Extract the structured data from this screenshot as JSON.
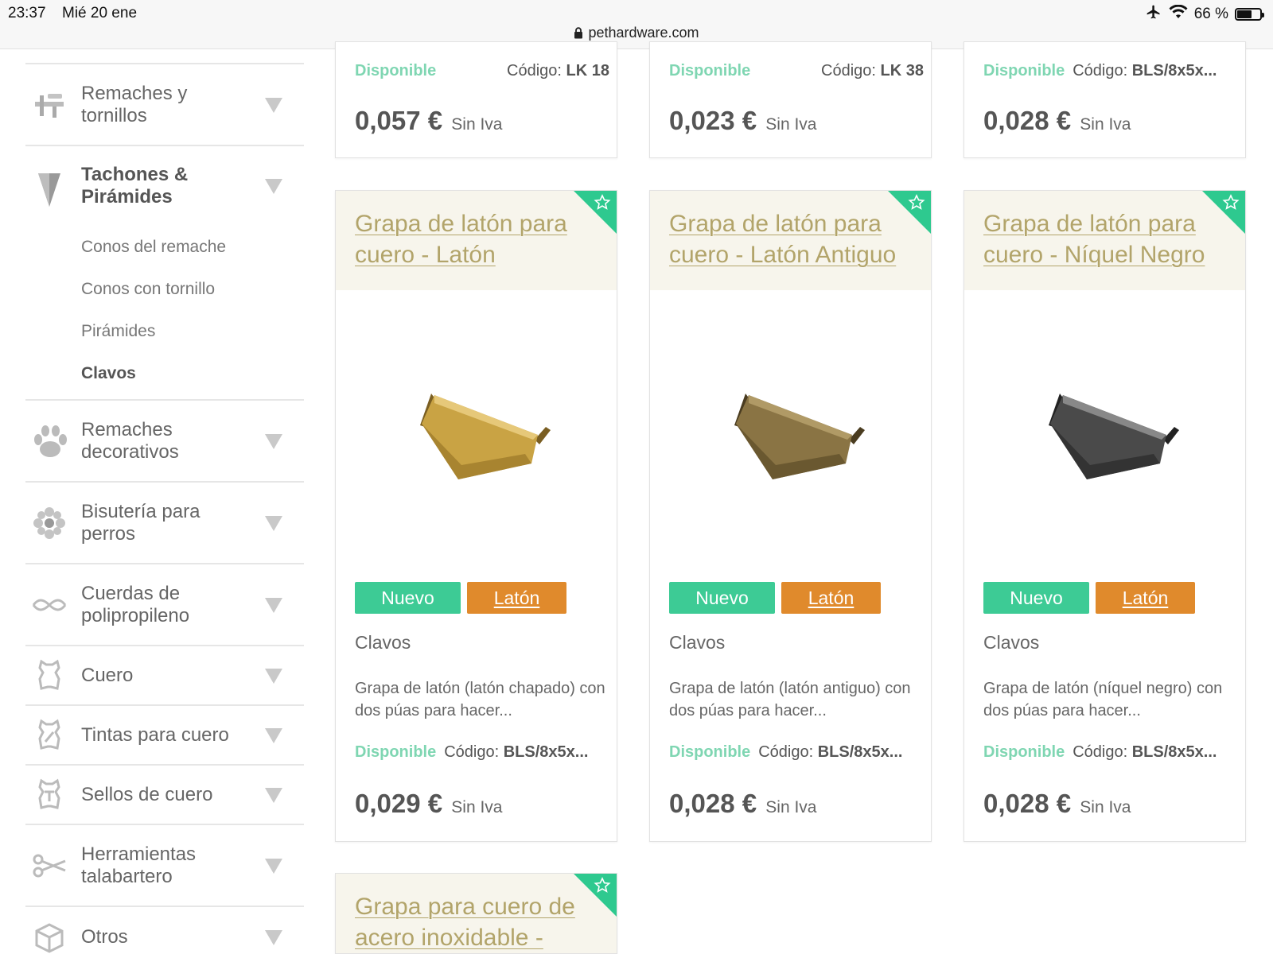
{
  "status_bar": {
    "time": "23:37",
    "date": "Mié 20 ene",
    "battery": "66 %",
    "battery_level": 0.66,
    "url": "pethardware.com"
  },
  "sidebar": {
    "categories_top": [
      {
        "label": "Remaches y tornillos",
        "icon": "rivet-tools-icon"
      },
      {
        "label": "Tachones & Pirámides",
        "icon": "stud-cone-icon",
        "active": true
      }
    ],
    "subcategories": [
      "Conos del remache",
      "Conos con tornillo",
      "Pirámides",
      "Clavos"
    ],
    "current_subcategory": "Clavos",
    "categories_bottom": [
      {
        "label": "Remaches decorativos",
        "icon": "paw-icon"
      },
      {
        "label": "Bisutería para perros",
        "icon": "flower-icon"
      },
      {
        "label": "Cuerdas de polipropileno",
        "icon": "rope-icon"
      },
      {
        "label": "Cuero",
        "icon": "hide-icon"
      },
      {
        "label": "Tintas para cuero",
        "icon": "leather-dye-icon"
      },
      {
        "label": "Sellos de cuero",
        "icon": "leather-stamp-icon"
      },
      {
        "label": "Herramientas talabartero",
        "icon": "scissors-icon"
      },
      {
        "label": "Otros",
        "icon": "box-icon"
      }
    ]
  },
  "products_top_row": [
    {
      "availability": "Disponible",
      "code_label": "Código:",
      "code": "LK 18",
      "price": "0,057 €",
      "price_suffix": "Sin Iva"
    },
    {
      "availability": "Disponible",
      "code_label": "Código:",
      "code": "LK 38",
      "price": "0,023 €",
      "price_suffix": "Sin Iva"
    },
    {
      "availability": "Disponible",
      "code_label": "Código:",
      "code": "BLS/8x5x...",
      "price": "0,028 €",
      "price_suffix": "Sin Iva"
    }
  ],
  "products": [
    {
      "title": "Grapa de latón para cuero - Latón",
      "tag_new": "Nuevo",
      "tag_material": "Latón",
      "category": "Clavos",
      "description": "Grapa de latón (latón chapado) con dos púas para hacer...",
      "availability": "Disponible",
      "code_label": "Código:",
      "code": "BLS/8x5x...",
      "price": "0,029 €",
      "price_suffix": "Sin Iva",
      "finish_color": "#c9a344"
    },
    {
      "title": "Grapa de latón para cuero - Latón Antiguo",
      "tag_new": "Nuevo",
      "tag_material": "Latón",
      "category": "Clavos",
      "description": "Grapa de latón (latón antiguo) con dos púas para hacer...",
      "availability": "Disponible",
      "code_label": "Código:",
      "code": "BLS/8x5x...",
      "price": "0,028 €",
      "price_suffix": "Sin Iva",
      "finish_color": "#8a7444"
    },
    {
      "title": "Grapa de latón para cuero - Níquel Negro",
      "tag_new": "Nuevo",
      "tag_material": "Latón",
      "category": "Clavos",
      "description": "Grapa de latón (níquel negro) con dos púas para hacer...",
      "availability": "Disponible",
      "code_label": "Código:",
      "code": "BLS/8x5x...",
      "price": "0,028 €",
      "price_suffix": "Sin Iva",
      "finish_color": "#4a4a4a"
    }
  ],
  "product_bottom": {
    "title": "Grapa para cuero de acero inoxidable -"
  },
  "colors": {
    "accent_green": "#3dcb95",
    "accent_orange": "#e08a2c",
    "title_gold": "#b2a46a",
    "ribbon_green": "#2ec98f"
  }
}
